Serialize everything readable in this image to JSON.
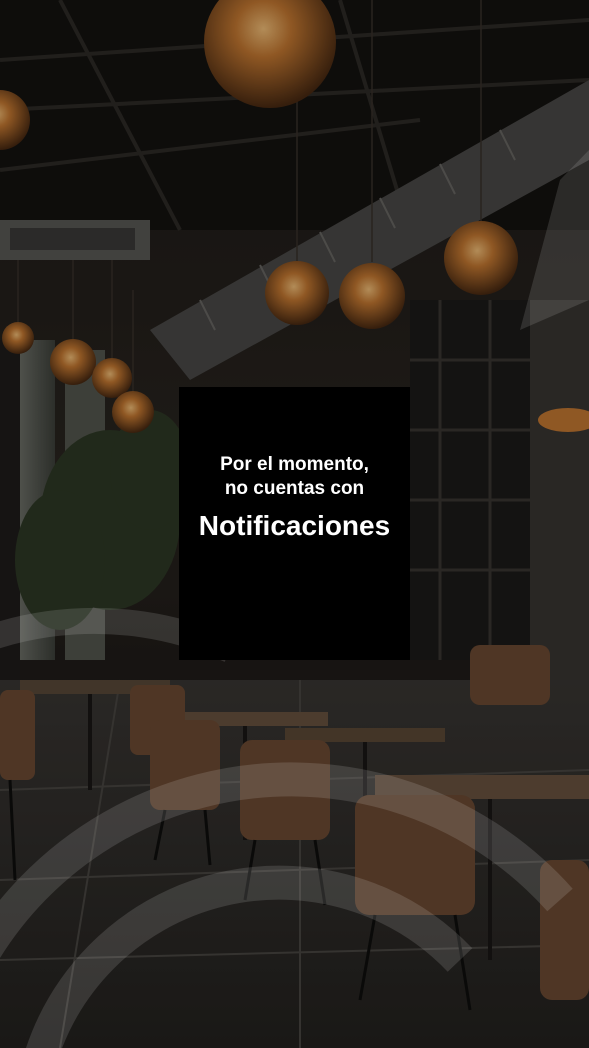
{
  "empty_state": {
    "line1": "Por el momento,",
    "line2": "no cuentas con",
    "title": "Notificaciones"
  },
  "background": {
    "scene": "restaurant-interior-photo",
    "overlay_color": "#000000",
    "accent_color": "#ffffff"
  }
}
